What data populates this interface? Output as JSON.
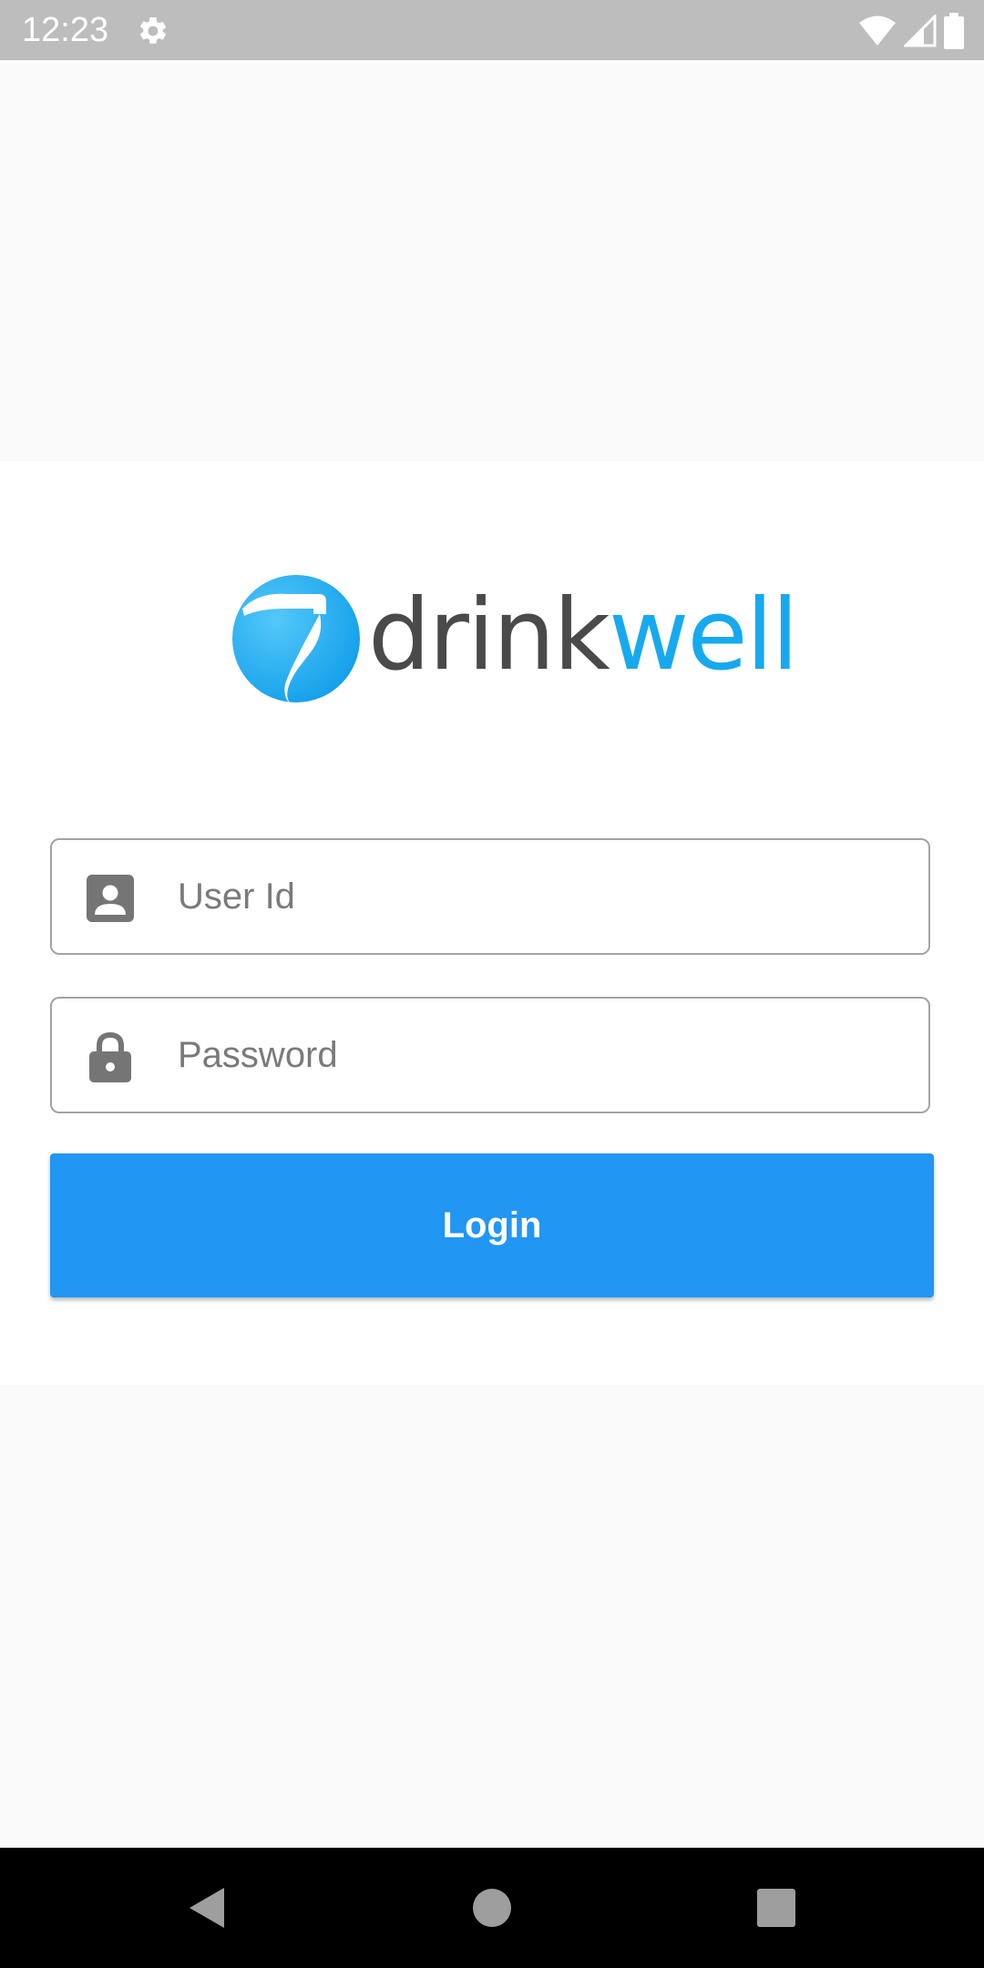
{
  "status_bar": {
    "time": "12:23",
    "icons": [
      "settings-gear-icon",
      "wifi-icon",
      "cell-signal-icon",
      "battery-icon"
    ]
  },
  "logo": {
    "text_dark": "drink",
    "text_blue": "well",
    "brand_blue": "#17a9ee",
    "text_dark_color": "#4a4a4a"
  },
  "form": {
    "user_id": {
      "placeholder": "User Id",
      "value": "",
      "icon": "account-box-icon"
    },
    "password": {
      "placeholder": "Password",
      "value": "",
      "icon": "lock-icon"
    },
    "login_label": "Login",
    "button_color": "#2196f3"
  },
  "nav_bar": {
    "icons": [
      "back-icon",
      "home-icon",
      "recents-icon"
    ]
  }
}
